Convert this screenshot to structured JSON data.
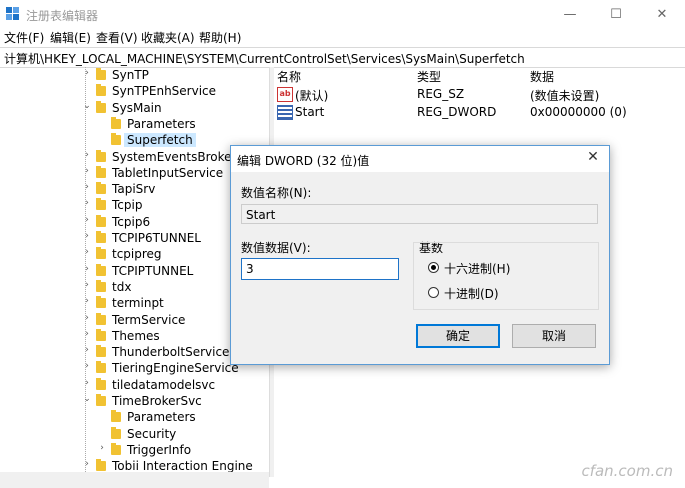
{
  "window": {
    "title": "注册表编辑器",
    "minimize": "—",
    "maximize": "☐",
    "close": "✕"
  },
  "menu": [
    "文件(F)",
    "编辑(E)",
    "查看(V)",
    "收藏夹(A)",
    "帮助(H)"
  ],
  "address": "计算机\\HKEY_LOCAL_MACHINE\\SYSTEM\\CurrentControlSet\\Services\\SysMain\\Superfetch",
  "tree": [
    {
      "label": "SynTP",
      "arrow": "›",
      "level": 0
    },
    {
      "label": "SynTPEnhService",
      "arrow": "",
      "level": 0
    },
    {
      "label": "SysMain",
      "arrow": "⌄",
      "level": 0
    },
    {
      "label": "Parameters",
      "arrow": "",
      "level": 1
    },
    {
      "label": "Superfetch",
      "arrow": "",
      "level": 1,
      "selected": true
    },
    {
      "label": "SystemEventsBroker",
      "arrow": "›",
      "level": 0
    },
    {
      "label": "TabletInputService",
      "arrow": "›",
      "level": 0
    },
    {
      "label": "TapiSrv",
      "arrow": "›",
      "level": 0
    },
    {
      "label": "Tcpip",
      "arrow": "›",
      "level": 0
    },
    {
      "label": "Tcpip6",
      "arrow": "›",
      "level": 0
    },
    {
      "label": "TCPIP6TUNNEL",
      "arrow": "›",
      "level": 0
    },
    {
      "label": "tcpipreg",
      "arrow": "›",
      "level": 0
    },
    {
      "label": "TCPIPTUNNEL",
      "arrow": "›",
      "level": 0
    },
    {
      "label": "tdx",
      "arrow": "›",
      "level": 0
    },
    {
      "label": "terminpt",
      "arrow": "›",
      "level": 0
    },
    {
      "label": "TermService",
      "arrow": "›",
      "level": 0
    },
    {
      "label": "Themes",
      "arrow": "›",
      "level": 0
    },
    {
      "label": "ThunderboltService",
      "arrow": "›",
      "level": 0
    },
    {
      "label": "TieringEngineService",
      "arrow": "›",
      "level": 0
    },
    {
      "label": "tiledatamodelsvc",
      "arrow": "›",
      "level": 0
    },
    {
      "label": "TimeBrokerSvc",
      "arrow": "⌄",
      "level": 0
    },
    {
      "label": "Parameters",
      "arrow": "",
      "level": 1
    },
    {
      "label": "Security",
      "arrow": "",
      "level": 1
    },
    {
      "label": "TriggerInfo",
      "arrow": "›",
      "level": 1
    },
    {
      "label": "Tobii Interaction Engine",
      "arrow": "›",
      "level": 0
    }
  ],
  "list": {
    "headers": {
      "name": "名称",
      "type": "类型",
      "data": "数据"
    },
    "rows": [
      {
        "icon": "string-value-icon",
        "icon_text": "ab",
        "name": "(默认)",
        "type": "REG_SZ",
        "data": "(数值未设置)"
      },
      {
        "icon": "binary-value-icon",
        "icon_text": "",
        "name": "Start",
        "type": "REG_DWORD",
        "data": "0x00000000 (0)"
      }
    ]
  },
  "dialog": {
    "title": "编辑 DWORD (32 位)值",
    "close": "✕",
    "name_label": "数值名称(N):",
    "name_value": "Start",
    "data_label": "数值数据(V):",
    "data_value": "3",
    "base_label": "基数",
    "radio_hex": "十六进制(H)",
    "radio_dec": "十进制(D)",
    "ok": "确定",
    "cancel": "取消"
  },
  "watermark": "cfan.com.cn"
}
